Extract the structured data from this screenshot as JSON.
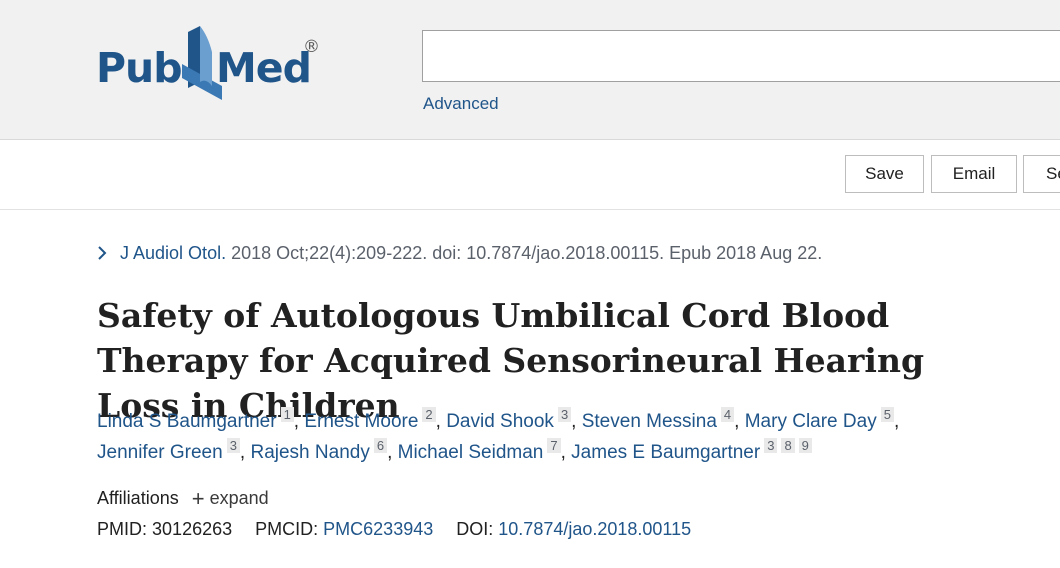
{
  "header": {
    "logo_pub": "Pub",
    "logo_med": "Med",
    "logo_reg": "®",
    "search_value": "",
    "advanced_label": "Advanced"
  },
  "actions": {
    "save_label": "Save",
    "email_label": "Email",
    "send_label": "Se"
  },
  "citation": {
    "journal": "J Audiol Otol.",
    "details": "2018 Oct;22(4):209-222. doi: 10.7874/jao.2018.00115. Epub 2018 Aug 22."
  },
  "article": {
    "title": "Safety of Autologous Umbilical Cord Blood Therapy for Acquired Sensorineural Hearing Loss in Children"
  },
  "authors": [
    {
      "name": "Linda S Baumgartner",
      "affils": [
        "1"
      ]
    },
    {
      "name": "Ernest Moore",
      "affils": [
        "2"
      ]
    },
    {
      "name": "David Shook",
      "affils": [
        "3"
      ]
    },
    {
      "name": "Steven Messina",
      "affils": [
        "4"
      ]
    },
    {
      "name": "Mary Clare Day",
      "affils": [
        "5"
      ]
    },
    {
      "name": "Jennifer Green",
      "affils": [
        "3"
      ]
    },
    {
      "name": "Rajesh Nandy",
      "affils": [
        "6"
      ]
    },
    {
      "name": "Michael Seidman",
      "affils": [
        "7"
      ]
    },
    {
      "name": "James E Baumgartner",
      "affils": [
        "3",
        "8",
        "9"
      ]
    }
  ],
  "affiliations": {
    "label": "Affiliations",
    "expand_label": "expand"
  },
  "identifiers": {
    "pmid_label": "PMID:",
    "pmid_value": "30126263",
    "pmcid_label": "PMCID:",
    "pmcid_value": "PMC6233943",
    "doi_label": "DOI:",
    "doi_value": "10.7874/jao.2018.00115"
  },
  "colors": {
    "brand_blue": "#20558a",
    "header_bg": "#f1f1f1",
    "text_muted": "#5b616b"
  }
}
